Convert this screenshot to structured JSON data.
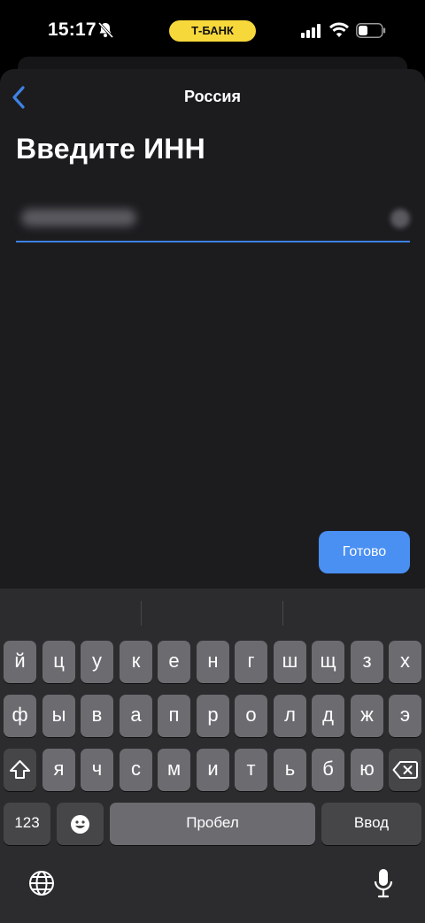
{
  "status_bar": {
    "time": "15:17",
    "carrier_pill": "Т-БАНК",
    "icons": [
      "bell-slash-icon",
      "cellular-signal-icon",
      "wifi-icon",
      "battery-icon"
    ]
  },
  "nav": {
    "back_icon": "chevron-left-icon",
    "title": "Россия"
  },
  "heading": "Введите ИНН",
  "inn_field": {
    "value": "",
    "value_state": "blurred",
    "clear_icon": "clear-icon"
  },
  "done_label": "Готово",
  "keyboard": {
    "row1": [
      "й",
      "ц",
      "у",
      "к",
      "е",
      "н",
      "г",
      "ш",
      "щ",
      "з",
      "х"
    ],
    "row2": [
      "ф",
      "ы",
      "в",
      "а",
      "п",
      "р",
      "о",
      "л",
      "д",
      "ж",
      "э"
    ],
    "row3": [
      "я",
      "ч",
      "с",
      "м",
      "и",
      "т",
      "ь",
      "б",
      "ю"
    ],
    "numbers_label": "123",
    "space_label": "Пробел",
    "return_label": "Ввод",
    "special_icons": [
      "shift-icon",
      "backspace-icon",
      "emoji-icon",
      "globe-icon",
      "microphone-icon"
    ]
  },
  "colors": {
    "accent": "#4a8ff2",
    "pill": "#f7d83b",
    "sheet_bg": "#1c1c1f",
    "keyboard_bg": "#2c2c2e",
    "key_bg": "#6b6b70",
    "key_dark_bg": "#464649"
  }
}
